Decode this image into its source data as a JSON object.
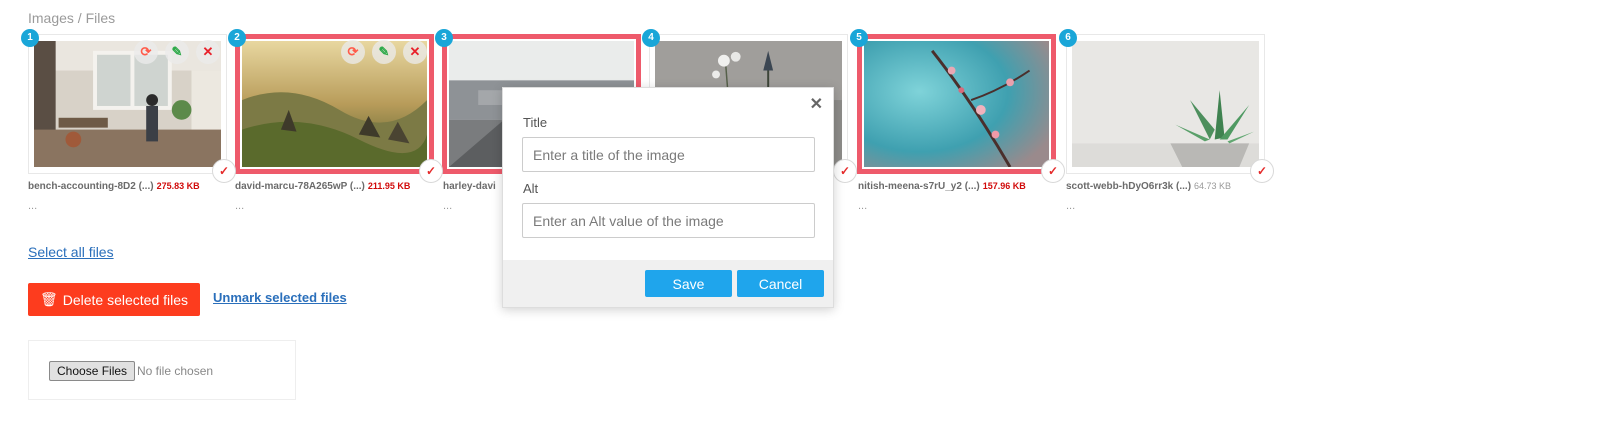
{
  "breadcrumb": "Images / Files",
  "files": [
    {
      "num": "1",
      "name": "bench-accounting-8D2 (...)",
      "size": "275.83 KB",
      "title": "...",
      "selected": false,
      "size_color": "red"
    },
    {
      "num": "2",
      "name": "david-marcu-78A265wP (...)",
      "size": "211.95 KB",
      "title": "...",
      "selected": true,
      "size_color": "red"
    },
    {
      "num": "3",
      "name": "harley-davi",
      "size": "",
      "title": "...",
      "selected": true,
      "size_color": "red"
    },
    {
      "num": "4",
      "name": "",
      "size": "",
      "title": "",
      "selected": false,
      "size_color": "red"
    },
    {
      "num": "5",
      "name": "nitish-meena-s7rU_y2 (...)",
      "size": "157.96 KB",
      "title": "...",
      "selected": true,
      "size_color": "red"
    },
    {
      "num": "6",
      "name": "scott-webb-hDyO6rr3k (...)",
      "size": "64.73 KB",
      "title": "...",
      "selected": false,
      "size_color": "grey"
    }
  ],
  "actions": {
    "reload_icon": "reload-icon",
    "edit_icon": "edit-icon",
    "delete_icon": "close-icon"
  },
  "select_all": "Select all files",
  "delete_selected": "Delete selected files",
  "unmark_selected": "Unmark selected files",
  "upload": {
    "button": "Choose Files",
    "status": "No file chosen"
  },
  "modal": {
    "title_label": "Title",
    "title_placeholder": "Enter a title of the image",
    "alt_label": "Alt",
    "alt_placeholder": "Enter an Alt value of the image",
    "save": "Save",
    "cancel": "Cancel"
  },
  "colors": {
    "selected_border": "#ee5a6b",
    "badge": "#1aa6d8",
    "delete_button": "#fd3c1e",
    "modal_button": "#1fa5ec",
    "link": "#2a6fbb"
  }
}
